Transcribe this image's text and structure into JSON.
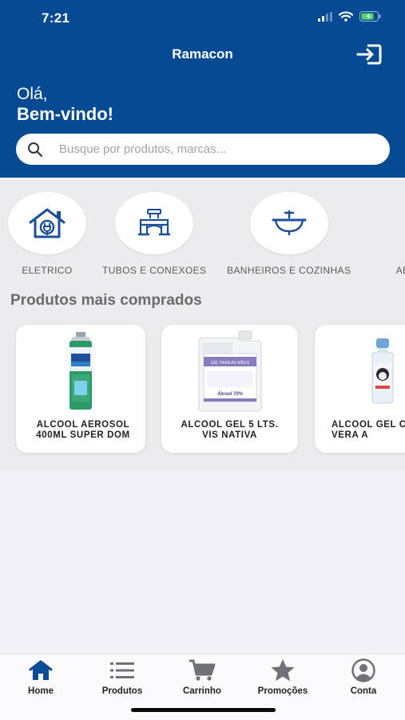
{
  "status_bar": {
    "time": "7:21"
  },
  "header": {
    "title": "Ramacon",
    "greeting": "Olá,",
    "welcome": "Bem-vindo!",
    "search_placeholder": "Busque por produtos, marcas..."
  },
  "categories": [
    {
      "label": "ELETRICO",
      "icon": "house-electric-icon"
    },
    {
      "label": "TUBOS E CONEXOES",
      "icon": "pipe-fitting-icon"
    },
    {
      "label": "BANHEIROS E COZINHAS",
      "icon": "sink-icon"
    },
    {
      "label": "ABRAS",
      "icon": "abrasive-icon"
    }
  ],
  "section": {
    "title": "Produtos mais comprados"
  },
  "products": [
    {
      "name": "ALCOOL AEROSOL 400ML SUPER DOM"
    },
    {
      "name": "ALCOOL GEL    5 LTS. VIS NATIVA",
      "label_text": "GEL PARA AS MÃOS",
      "label_sub": "Álcool 70%"
    },
    {
      "name": "ALCOOL GEL C/ALOE VERA A"
    }
  ],
  "tabbar": {
    "home": "Home",
    "products": "Produtos",
    "cart": "Carrinho",
    "promos": "Promoções",
    "account": "Conta"
  },
  "colors": {
    "brand": "#064a93",
    "background": "#f2f2f6"
  }
}
